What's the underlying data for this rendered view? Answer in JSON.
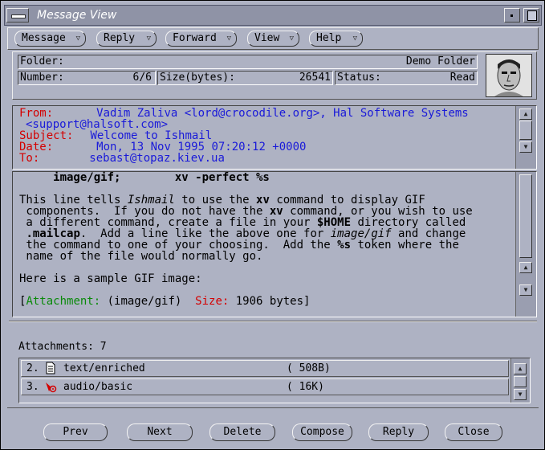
{
  "window": {
    "title": "Message View"
  },
  "menubar": {
    "items": [
      {
        "label": "Message"
      },
      {
        "label": "Reply"
      },
      {
        "label": "Forward"
      },
      {
        "label": "View"
      },
      {
        "label": "Help"
      }
    ]
  },
  "header": {
    "folder_label": "Folder:",
    "folder_value": "Demo Folder",
    "number_label": "Number:",
    "number_value": "6/6",
    "size_label": "Size(bytes):",
    "size_value": "26541",
    "status_label": "Status:",
    "status_value": "Read"
  },
  "message_headers": {
    "from_label": "From:",
    "from_value": "Vadim Zaliva <lord@crocodile.org>, Hal Software Systems",
    "from_value_cont": "<support@halsoft.com>",
    "subject_label": "Subject:",
    "subject_value": "Welcome to Ishmail",
    "date_label": "Date:",
    "date_value": "Mon, 13 Nov 1995 07:20:12 +0000",
    "to_label": "To:",
    "to_value": "sebast@topaz.kiev.ua"
  },
  "body": {
    "l0_a": "     image/gif;        xv -perfect %s",
    "l1_a": "This line tells ",
    "l1_b": "Ishmail",
    "l1_c": " to use the ",
    "l1_d": "xv",
    "l1_e": " command to display GIF",
    "l2_a": " components.  If you do not have the ",
    "l2_b": "xv",
    "l2_c": " command, or you wish to use",
    "l3_a": " a different command, create a file in your ",
    "l3_b": "$HOME",
    "l3_c": " directory called",
    "l4_a": " ",
    "l4_b": ".mailcap",
    "l4_c": ".  Add a line like the above one for ",
    "l4_d": "image/gif",
    "l4_e": " and change",
    "l5_a": " the command to one of your choosing.  Add the ",
    "l5_b": "%s",
    "l5_c": " token where the",
    "l6": " name of the file would normally go.",
    "l7": "Here is a sample GIF image:",
    "att_open": "[",
    "att_label": "Attachment:",
    "att_type": " (image/gif)  ",
    "att_size_label": "Size:",
    "att_size": " 1906 bytes]"
  },
  "attachments": {
    "label": "Attachments: 7",
    "items": [
      {
        "num": "2.",
        "icon": "document-icon",
        "type": "text/enriched",
        "size": "( 508B)"
      },
      {
        "num": "3.",
        "icon": "audio-speaker-icon",
        "type": "audio/basic",
        "size": "(  16K)"
      }
    ]
  },
  "buttons": {
    "prev": "Prev",
    "next": "Next",
    "delete": "Delete",
    "compose": "Compose",
    "reply": "Reply",
    "close": "Close"
  },
  "colors": {
    "window_bg": "#aeb2c3",
    "title_bg": "#8f93a6",
    "header_label": "#d40000",
    "header_value": "#1a1ad9",
    "attachment_label": "#0a8a0a",
    "size_label": "#d40000"
  }
}
